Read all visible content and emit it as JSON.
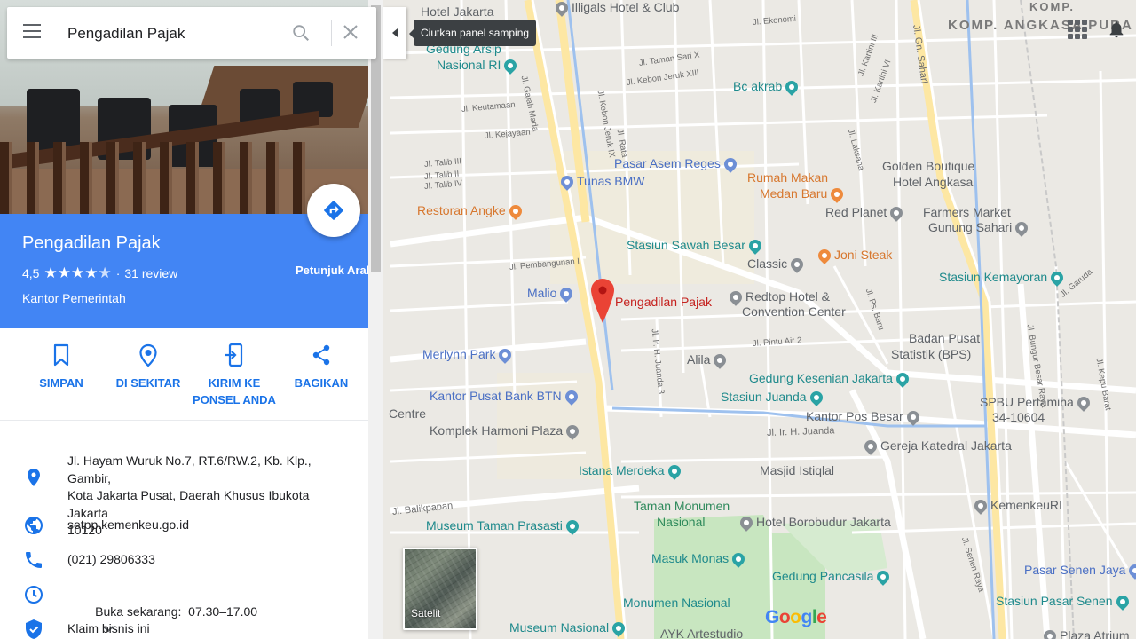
{
  "search": {
    "query": "Pengadilan Pajak"
  },
  "tooltip": "Ciutkan panel samping",
  "place": {
    "name": "Pengadilan Pajak",
    "rating": "4,5",
    "stars": 4.5,
    "reviews": "31 review",
    "category": "Kantor Pemerintah",
    "directions_label": "Petunjuk Arah"
  },
  "actions": [
    {
      "label1": "SIMPAN",
      "label2": "",
      "icon": "bookmark-icon"
    },
    {
      "label1": "DI SEKITAR",
      "label2": "",
      "icon": "nearby-pin-icon"
    },
    {
      "label1": "KIRIM KE",
      "label2": "PONSEL ANDA",
      "icon": "send-to-phone-icon"
    },
    {
      "label1": "BAGIKAN",
      "label2": "",
      "icon": "share-icon"
    }
  ],
  "info": {
    "address_lines": [
      "Jl. Hayam Wuruk No.7, RT.6/RW.2, Kb. Klp., Gambir,",
      "Kota Jakarta Pusat, Daerah Khusus Ibukota Jakarta",
      "10120"
    ],
    "website": "setpp.kemenkeu.go.id",
    "phone": "(021) 29806333",
    "hours": "Buka sekarang:  07.30–17.00",
    "claim": "Klaim bisnis ini"
  },
  "map": {
    "marker_label": "Pengadilan Pajak",
    "satellite_label": "Satelit",
    "area_label": "KOMP. ANGKASA PURA",
    "logo": [
      "G",
      "o",
      "o",
      "g",
      "l",
      "e"
    ],
    "pois": [
      {
        "text": "Hotel Jakarta",
        "color": "grey"
      },
      {
        "text": "Illigals Hotel & Club",
        "color": "grey"
      },
      {
        "text": "Gedung Arsip",
        "color": "teal"
      },
      {
        "text": "Nasional RI",
        "color": "teal"
      },
      {
        "text": "Bc akrab",
        "color": "teal"
      },
      {
        "text": "Pasar Asem Reges",
        "color": "blue"
      },
      {
        "text": "Tunas BMW",
        "color": "blue"
      },
      {
        "text": "Rumah Makan",
        "color": "orange"
      },
      {
        "text": "Medan Baru",
        "color": "orange"
      },
      {
        "text": "Golden Boutique",
        "color": "grey"
      },
      {
        "text": "Hotel Angkasa",
        "color": "grey"
      },
      {
        "text": "Restoran Angke",
        "color": "orange"
      },
      {
        "text": "Red Planet",
        "color": "grey"
      },
      {
        "text": "Farmers Market",
        "color": "grey"
      },
      {
        "text": "Gunung Sahari",
        "color": "grey"
      },
      {
        "text": "Stasiun Sawah Besar",
        "color": "teal"
      },
      {
        "text": "Joni Steak",
        "color": "orange"
      },
      {
        "text": "Classic",
        "color": "grey"
      },
      {
        "text": "Stasiun Kemayoran",
        "color": "teal"
      },
      {
        "text": "Malio",
        "color": "blue"
      },
      {
        "text": "Redtop Hotel &",
        "color": "grey"
      },
      {
        "text": "Convention Center",
        "color": "grey"
      },
      {
        "text": "Badan Pusat",
        "color": "grey"
      },
      {
        "text": "Statistik (BPS)",
        "color": "grey"
      },
      {
        "text": "Merlynn Park",
        "color": "blue"
      },
      {
        "text": "Alila",
        "color": "grey"
      },
      {
        "text": "Gedung Kesenian Jakarta",
        "color": "teal"
      },
      {
        "text": "Stasiun Juanda",
        "color": "teal"
      },
      {
        "text": "Kantor Pusat Bank BTN",
        "color": "blue"
      },
      {
        "text": "Kantor Pos Besar",
        "color": "grey"
      },
      {
        "text": "SPBU Pertamina",
        "color": "grey"
      },
      {
        "text": "34-10604",
        "color": "grey"
      },
      {
        "text": "Komplek Harmoni Plaza",
        "color": "grey"
      },
      {
        "text": "Gereja Katedral Jakarta",
        "color": "grey"
      },
      {
        "text": "Istana Merdeka",
        "color": "teal"
      },
      {
        "text": "Masjid Istiqlal",
        "color": "grey"
      },
      {
        "text": "Taman Monumen",
        "color": "green"
      },
      {
        "text": "Nasional",
        "color": "green"
      },
      {
        "text": "Hotel Borobudur Jakarta",
        "color": "grey"
      },
      {
        "text": "KemenkeuRI",
        "color": "grey"
      },
      {
        "text": "Museum Taman Prasasti",
        "color": "teal"
      },
      {
        "text": "Masuk Monas",
        "color": "teal"
      },
      {
        "text": "Gedung Pancasila",
        "color": "teal"
      },
      {
        "text": "Pasar Senen Jaya",
        "color": "blue"
      },
      {
        "text": "Monumen Nasional",
        "color": "teal"
      },
      {
        "text": "Stasiun Pasar Senen",
        "color": "teal"
      },
      {
        "text": "Museum Nasional",
        "color": "teal"
      },
      {
        "text": "AYK Artestudio",
        "color": "grey"
      },
      {
        "text": "Plaza Atrium",
        "color": "grey"
      },
      {
        "text": "Centre",
        "color": "grey"
      }
    ],
    "streets": [
      "Jl. Gajah Mada",
      "Jl. Taman Sari X",
      "Jl. Kebon Jeruk XIII",
      "Jl. Keutamaan",
      "Jl. Kejayaan",
      "Jl. Kebon Jeruk IX",
      "Jl. Rata",
      "Jl. Talib III",
      "Jl. Talib II",
      "Jl. Talib IV",
      "Jl. Pembangunan I",
      "Jl. Ir. H. Juanda 3",
      "Jl. Pintu Air 2",
      "Jl. Ir. H. Juanda",
      "Jl. Balikpapan",
      "Jl. Gn. Sahari",
      "Jl. Laksana",
      "Jl. Garuda",
      "Jl. Bungur Besar Raya",
      "Jl. Kepu Barat",
      "Jl. Senen Raya",
      "Jl. Ps. Baru",
      "Jl. Ekonomi",
      "Jl. Kartini III",
      "Jl. Kartini VI"
    ]
  }
}
